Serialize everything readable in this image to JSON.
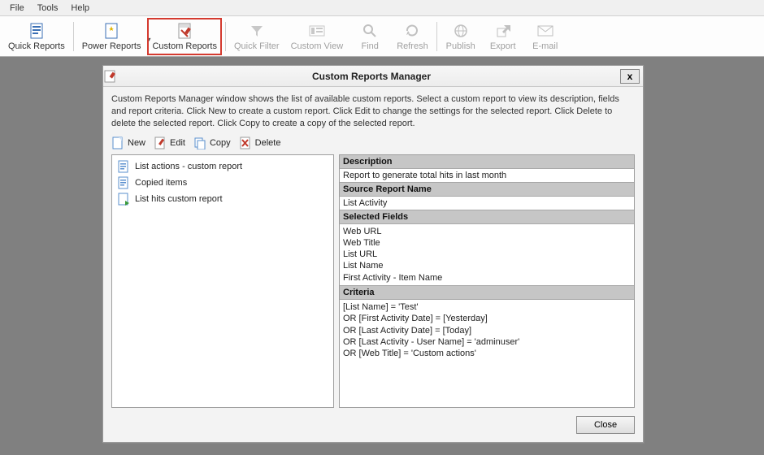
{
  "menubar": {
    "file": "File",
    "tools": "Tools",
    "help": "Help"
  },
  "toolbar": {
    "quick_reports": "Quick Reports",
    "power_reports": "Power Reports",
    "custom_reports": "Custom Reports",
    "quick_filter": "Quick Filter",
    "custom_view": "Custom View",
    "find": "Find",
    "refresh": "Refresh",
    "publish": "Publish",
    "export": "Export",
    "email": "E-mail"
  },
  "dialog": {
    "title": "Custom Reports Manager",
    "close_x": "x",
    "help": "Custom Reports Manager window shows the list of available custom reports. Select a custom report to view its description, fields and report criteria. Click New to create a custom report. Click Edit to change the settings for the selected report. Click Delete to delete the selected report. Click Copy to create a copy of the selected report.",
    "buttons": {
      "new": "New",
      "edit": "Edit",
      "copy": "Copy",
      "delete": "Delete",
      "close": "Close"
    },
    "list": {
      "items": [
        "List actions - custom report",
        "Copied items",
        "List hits custom report"
      ]
    },
    "detail": {
      "description_label": "Description",
      "description_value": "Report to generate total hits in last month",
      "source_label": "Source Report Name",
      "source_value": "List Activity",
      "fields_label": "Selected Fields",
      "fields_value": "Web URL\nWeb Title\nList URL\nList Name\nFirst Activity - Item Name",
      "criteria_label": "Criteria",
      "criteria_value": "[List Name] = 'Test'\nOR   [First Activity Date] = [Yesterday]\nOR   [Last Activity Date] = [Today]\nOR   [Last Activity - User Name] = 'adminuser'\nOR   [Web Title] = 'Custom actions'"
    }
  }
}
